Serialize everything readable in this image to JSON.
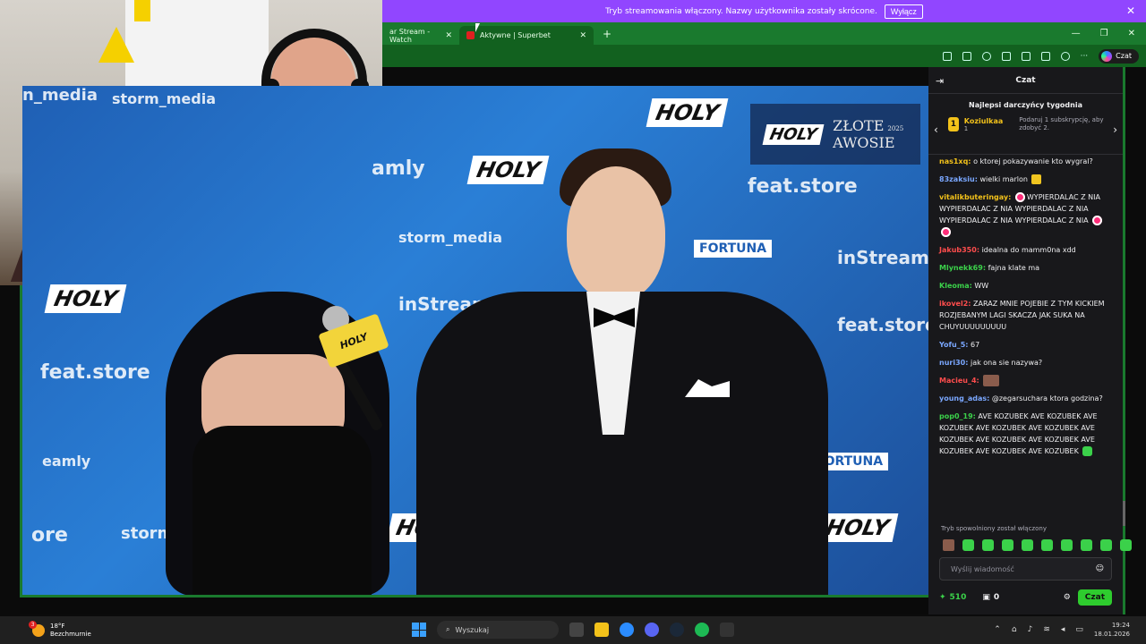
{
  "banner": {
    "message": "Tryb streamowania włączony. Nazwy użytkownika zostały skrócone.",
    "disable_button": "Wyłącz",
    "close": "✕"
  },
  "browser": {
    "tabs": [
      {
        "label": "ar Stream - Watch",
        "close": "✕"
      },
      {
        "label": "Aktywne | Superbet",
        "close": "✕"
      }
    ],
    "new_tab": "+",
    "window_controls": [
      "—",
      "❐",
      "✕"
    ],
    "copilot_label": "Czat"
  },
  "video": {
    "overlay_title": "ZŁOTE",
    "overlay_subtitle": "AWOSIE",
    "overlay_year": "2025",
    "holy_logo": "HOLY",
    "backdrop_words": [
      "storm_media",
      "feat.store",
      "inStream",
      "FORTUNA",
      "amly",
      "ore",
      "n_media",
      "eamly"
    ]
  },
  "chat": {
    "title": "Czat",
    "leaderboard_title": "Najlepsi darczyńcy tygodnia",
    "leaderboard_entry": {
      "rank": "1",
      "name": "Koziulkaa",
      "count": "1"
    },
    "leaderboard_hint": "Podaruj 1 subskrypcję, aby zdobyć 2.",
    "messages": [
      {
        "user": "nas1xq:",
        "color": "#f3c21a",
        "text": "o ktorej pokazywanie kto wygral?"
      },
      {
        "user": "83zaksiu:",
        "color": "#7aa7ff",
        "text": "wielki marlon"
      },
      {
        "user": "vitalikbuteringay:",
        "color": "#f3c21a",
        "text": "WYPIERDALAC Z NIA  WYPIERDALAC Z NIA  WYPIERDALAC Z NIA  WYPIERDALAC Z NIA  WYPIERDALAC Z NIA"
      },
      {
        "user": "Jakub350:",
        "color": "#ff4d4d",
        "text": "idealna do mamm0na xdd"
      },
      {
        "user": "Mlynekk69:",
        "color": "#3bd14a",
        "text": "fajna klate ma"
      },
      {
        "user": "Kleoma:",
        "color": "#3bd14a",
        "text": "WW"
      },
      {
        "user": "ikovel2:",
        "color": "#ff4d4d",
        "text": "ZARAZ MNIE POJEBIE Z TYM KICKIEM ROZJEBANYM LAGI SKACZA JAK SUKA NA CHUYUUUUUUUUU"
      },
      {
        "user": "Yofu_5:",
        "color": "#7aa7ff",
        "text": "67"
      },
      {
        "user": "nuri30:",
        "color": "#7aa7ff",
        "text": "jak ona sie nazywa?"
      },
      {
        "user": "Macieu_4:",
        "color": "#ff4d4d",
        "text": ""
      },
      {
        "user": "young_adas:",
        "color": "#7aa7ff",
        "text": "@zegarsuchara ktora godzina?"
      },
      {
        "user": "pop0_19:",
        "color": "#3bd14a",
        "text": "AVE KOZUBEK  AVE KOZUBEK  AVE KOZUBEK  AVE KOZUBEK  AVE KOZUBEK  AVE KOZUBEK  AVE KOZUBEK  AVE KOZUBEK  AVE KOZUBEK  AVE KOZUBEK  AVE KOZUBEK"
      }
    ],
    "slow_mode_notice": "Tryb spowolniony został włączony",
    "input_placeholder": "Wyślij wiadomość",
    "points": "510",
    "bag_count": "0",
    "send_button": "Czat"
  },
  "taskbar": {
    "weather_temp": "18°F",
    "weather_desc": "Bezchmurnie",
    "weather_badge": "3",
    "search_placeholder": "Wyszukaj",
    "time": "19:24",
    "date": "18.01.2026"
  }
}
